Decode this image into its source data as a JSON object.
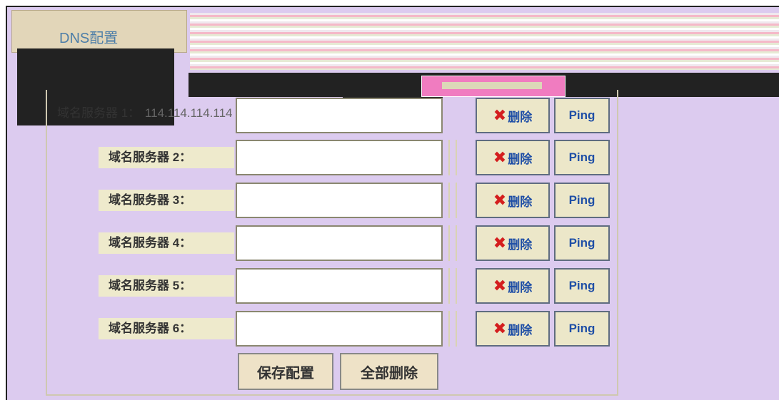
{
  "panel": {
    "title": "DNS配置"
  },
  "servers": [
    {
      "label": "域名服务器 1：",
      "value": "114.114.114.114"
    },
    {
      "label": "域名服务器 2：",
      "value": ""
    },
    {
      "label": "域名服务器 3：",
      "value": ""
    },
    {
      "label": "域名服务器 4：",
      "value": ""
    },
    {
      "label": "域名服务器 5：",
      "value": ""
    },
    {
      "label": "域名服务器 6：",
      "value": ""
    }
  ],
  "buttons": {
    "delete_label": "删除",
    "ping_label": "Ping",
    "save_label": "保存配置",
    "delete_all_label": "全部删除"
  },
  "icons": {
    "delete": "close-icon"
  },
  "colors": {
    "background": "#dccbef",
    "delete_icon": "#d41e1e",
    "button_text": "#1f4fa6",
    "title_text": "#4d7ea8"
  }
}
